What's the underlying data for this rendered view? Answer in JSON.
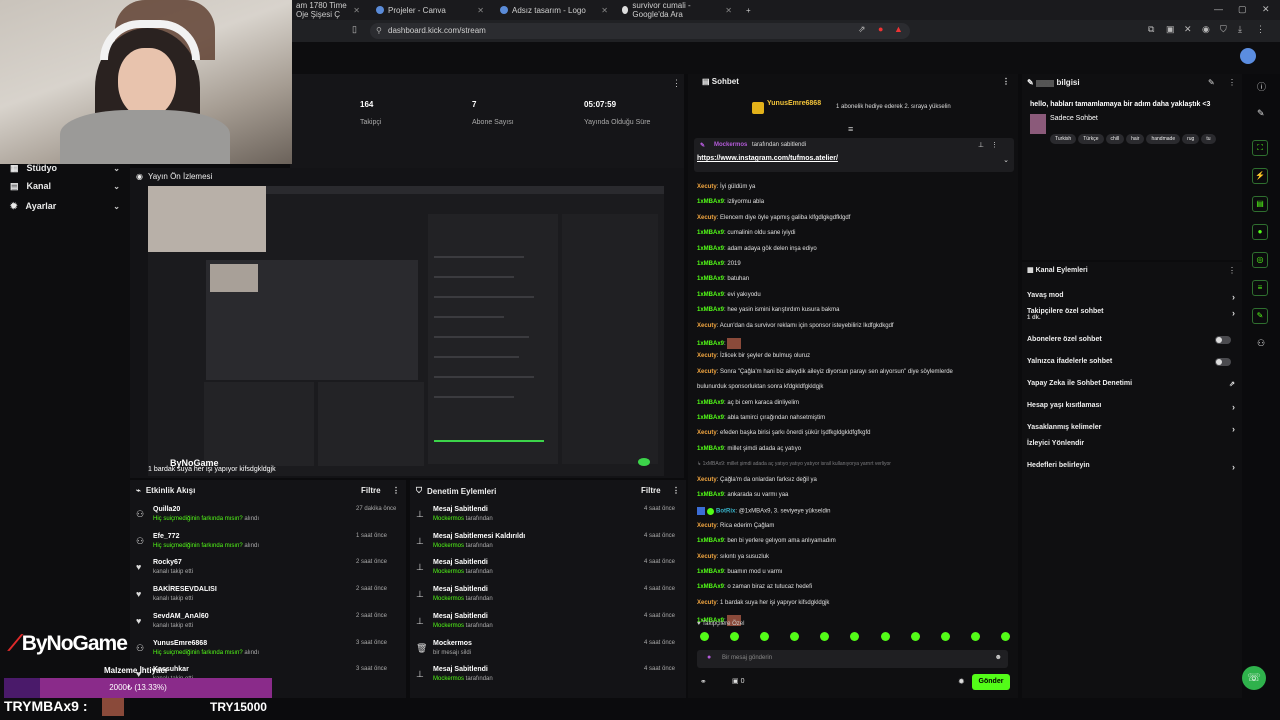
{
  "browser": {
    "tabs": [
      {
        "label": "am 1780 Time Oje Şişesi Ç"
      },
      {
        "label": "Projeler - Canva"
      },
      {
        "label": "Adsız tasarım - Logo"
      },
      {
        "label": "survivor cumali - Google'da Ara"
      }
    ],
    "new_tab": "+",
    "url": "dashboard.kick.com/stream"
  },
  "nav": {
    "items": [
      {
        "label": "Stüdyo"
      },
      {
        "label": "Kanal"
      },
      {
        "label": "Ayarlar"
      }
    ]
  },
  "stats": [
    {
      "value": "164",
      "label": "Takipçi"
    },
    {
      "value": "7",
      "label": "Abone Sayısı"
    },
    {
      "value": "05:07:59",
      "label": "Yayında Olduğu Süre"
    }
  ],
  "preview": {
    "title": "Yayın Ön İzlemesi",
    "caption": "1 bardak suya her işi yapıyor kifsdgkldgjk",
    "brand": "ByNoGame"
  },
  "activity": {
    "title": "Etkinlik Akışı",
    "filter": "Filtre",
    "rows": [
      {
        "icon": "activity-user-icon",
        "name": "Quilla20",
        "sub_green": "Hiç suiçmediğinin farkında mısın?",
        "sub": " alındı",
        "time": "27 dakika önce"
      },
      {
        "icon": "activity-user-icon",
        "name": "Efe_772",
        "sub_green": "Hiç suiçmediğinin farkında mısın?",
        "sub": " alındı",
        "time": "1 saat önce"
      },
      {
        "icon": "heart-icon",
        "name": "Rocky67",
        "sub_green": "",
        "sub": "kanalı takip etti",
        "time": "2 saat önce"
      },
      {
        "icon": "heart-icon",
        "name": "BAKİRESEVDALISI",
        "sub_green": "",
        "sub": "kanalı takip etti",
        "time": "2 saat önce"
      },
      {
        "icon": "heart-icon",
        "name": "SevdAM_AnAl60",
        "sub_green": "",
        "sub": "kanalı takip etti",
        "time": "2 saat önce"
      },
      {
        "icon": "activity-user-icon",
        "name": "YunusEmre6868",
        "sub_green": "Hiç suiçmediğinin farkında mısın?",
        "sub": " alındı",
        "time": "3 saat önce"
      },
      {
        "icon": "heart-icon",
        "name": "Kassuhkar",
        "sub_green": "",
        "sub": "kanalı takip etti",
        "time": "3 saat önce"
      }
    ]
  },
  "moderation": {
    "title": "Denetim Eylemleri",
    "filter": "Filtre",
    "rows": [
      {
        "icon": "pin-icon",
        "name": "Mesaj Sabitlendi",
        "sub_green": "Mockermos",
        "sub": " tarafından",
        "time": "4 saat önce"
      },
      {
        "icon": "pin-icon",
        "name": "Mesaj Sabitlemesi Kaldırıldı",
        "sub_green": "Mockermos",
        "sub": " tarafından",
        "time": "4 saat önce"
      },
      {
        "icon": "pin-icon",
        "name": "Mesaj Sabitlendi",
        "sub_green": "Mockermos",
        "sub": " tarafından",
        "time": "4 saat önce"
      },
      {
        "icon": "pin-icon",
        "name": "Mesaj Sabitlendi",
        "sub_green": "Mockermos",
        "sub": " tarafından",
        "time": "4 saat önce"
      },
      {
        "icon": "pin-icon",
        "name": "Mesaj Sabitlendi",
        "sub_green": "Mockermos",
        "sub": " tarafından",
        "time": "4 saat önce"
      },
      {
        "icon": "trash-icon",
        "name": "Mockermos",
        "sub_green": "",
        "sub": "bir mesajı sildi",
        "time": "4 saat önce"
      },
      {
        "icon": "pin-icon",
        "name": "Mesaj Sabitlendi",
        "sub_green": "Mockermos",
        "sub": " tarafından",
        "time": "4 saat önce"
      }
    ]
  },
  "chat": {
    "title": "Sohbet",
    "gift_user": "YunusEmre6868",
    "gift_text": "1 abonelik hediye ederek 2. sıraya yükselin",
    "pinned_by": "Mockermos",
    "pinned_suffix": " tarafından sabitlendi",
    "pinned_link": "https://www.instagram.com/tufmos.atelier/",
    "messages": [
      {
        "user": "Xecuty",
        "color": "orange",
        "text": "İyi güldüm ya"
      },
      {
        "user": "1xMBAx9",
        "color": "green",
        "text": "izliyormu abla"
      },
      {
        "user": "Xecuty",
        "color": "orange",
        "text": "Elencem diye öyle yapmış galiba klfgdlgkgdfklgdf"
      },
      {
        "user": "1xMBAx9",
        "color": "green",
        "text": "cumalinin oldu sane iyiydi"
      },
      {
        "user": "1xMBAx9",
        "color": "green",
        "text": "adam adaya gök delen inşa ediyo"
      },
      {
        "user": "1xMBAx9",
        "color": "green",
        "text": "2019"
      },
      {
        "user": "1xMBAx9",
        "color": "green",
        "text": "batuhan"
      },
      {
        "user": "1xMBAx9",
        "color": "green",
        "text": "evi yakıyodu"
      },
      {
        "user": "1xMBAx9",
        "color": "green",
        "text": "hee yasin ismini karıştırdım kusura bakma"
      },
      {
        "user": "Xecuty",
        "color": "orange",
        "text": "Acun'dan da survivor reklamı için sponsor isteyebiliriz lkdfgkdkgdf"
      },
      {
        "user": "1xMBAx9",
        "color": "green",
        "text": ""
      },
      {
        "user": "Xecuty",
        "color": "orange",
        "text": "İzlicek bir şeyler de bulmuş oluruz"
      },
      {
        "user": "Xecuty",
        "color": "orange",
        "text": "Sonra \"Çağla'm hani biz aileydik aileyiz diyorsun parayı sen alıyorsun\" diye söylemlerde"
      },
      {
        "user": "",
        "color": "none",
        "text": "bulunurduk sponsorluktan sonra kfdgkldfgkldgjk"
      },
      {
        "user": "1xMBAx9",
        "color": "green",
        "text": "aç bi cem karaca dinliyelim"
      },
      {
        "user": "1xMBAx9",
        "color": "green",
        "text": "abla tamirci çırağından nahsetmiştim"
      },
      {
        "user": "Xecuty",
        "color": "orange",
        "text": "efeden başka birisi şarkı önerdi şükür lşdfkgldgkldfgfkgfd"
      },
      {
        "user": "1xMBAx9",
        "color": "green",
        "text": "millet şimdi adada aç yatıyo"
      },
      {
        "user": "",
        "color": "gray",
        "text": "↳ 1xMBAx9: millet şimdi adada aç yatıyo yatıyo yatıyor israil kullanıyorya yarrırt verliyor"
      },
      {
        "user": "Xecuty",
        "color": "orange",
        "text": "Çağla'm da onlardan farksız değil ya"
      },
      {
        "user": "1xMBAx9",
        "color": "green",
        "text": "ankarada su varmı yaa"
      },
      {
        "user": "BotRix",
        "color": "teal",
        "text": "@1xMBAx9, 3. seviyeye yükseldin"
      },
      {
        "user": "Xecuty",
        "color": "orange",
        "text": "Rica ederim Çağlam"
      },
      {
        "user": "1xMBAx9",
        "color": "green",
        "text": "ben bi yerlere gelıyom ama anlıyamadım"
      },
      {
        "user": "Xecuty",
        "color": "orange",
        "text": "sıkıntı ya susuzluk"
      },
      {
        "user": "1xMBAx9",
        "color": "green",
        "text": "buamın mod u varmı"
      },
      {
        "user": "1xMBAx9",
        "color": "green",
        "text": "o zaman biraz az tutucaz hedefi"
      },
      {
        "user": "Xecuty",
        "color": "orange",
        "text": "1 bardak suya her işi yapıyor kifsdgkldgjk"
      },
      {
        "user": "1xMBAx9",
        "color": "green",
        "text": ""
      }
    ],
    "followers_only": "Takipçilere Özel",
    "input_placeholder": "Bir mesaj gönderin",
    "counter": "0",
    "send": "Gönder"
  },
  "stream_info": {
    "title": "bilgisi",
    "headline": "hello, habları tamamlamaya bir adım daha yaklaştık <3",
    "category": "Sadece Sohbet",
    "tags": [
      "Turkish",
      "Türkçe",
      "chill",
      "hair",
      "handmade",
      "rug",
      "tu"
    ]
  },
  "channel_actions": {
    "title": "Kanal Eylemleri",
    "items": [
      {
        "label": "Yavaş mod",
        "sub": "",
        "control": "chevron"
      },
      {
        "label": "Takipçilere özel sohbet",
        "sub": "1 dk.",
        "control": "chevron"
      },
      {
        "label": "Abonelere özel sohbet",
        "sub": "",
        "control": "toggle"
      },
      {
        "label": "Yalnızca ifadelerle sohbet",
        "sub": "",
        "control": "toggle"
      },
      {
        "label": "Yapay Zeka ile Sohbet Denetimi",
        "sub": "",
        "control": "external"
      },
      {
        "label": "Hesap yaşı kısıtlaması",
        "sub": "",
        "control": "chevron"
      },
      {
        "label": "Yasaklanmış kelimeler",
        "sub": "",
        "control": "chevron"
      },
      {
        "label": "İzleyici Yönlendir",
        "sub": "",
        "control": "none"
      },
      {
        "label": "Hedefleri belirleyin",
        "sub": "",
        "control": "chevron"
      }
    ]
  },
  "overlay": {
    "brand": "ByNoGame",
    "goal_title": "Malzeme İhtiyacı",
    "goal_text": "2000₺ (13.33%)",
    "goal_progress": 0.1333,
    "bottom_left": "TRYMBAx9 :",
    "bottom_right": "TRY15000"
  },
  "colors": {
    "accent": "#53fc18",
    "goal_bar": "#8a2b8a"
  }
}
